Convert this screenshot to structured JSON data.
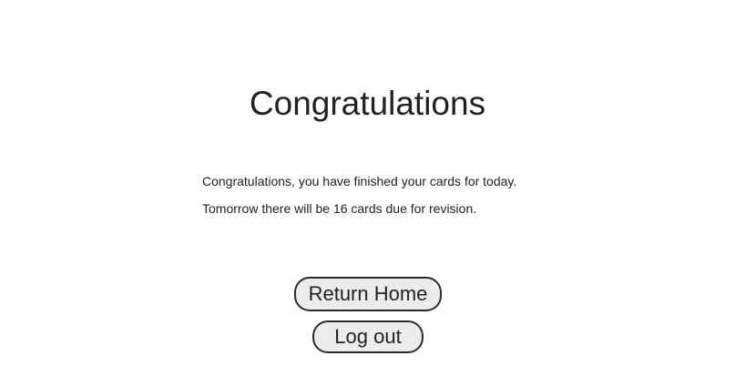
{
  "page": {
    "title": "Congratulations"
  },
  "message": {
    "line1": "Congratulations, you have finished your cards for today.",
    "line2": "Tomorrow there will be 16 cards due for revision."
  },
  "actions": {
    "return_home_label": "Return Home",
    "logout_label": "Log out"
  },
  "colors": {
    "background": "#ffffff",
    "text": "#222222",
    "button_fill": "#ececec",
    "button_border": "#2b2b2b"
  }
}
